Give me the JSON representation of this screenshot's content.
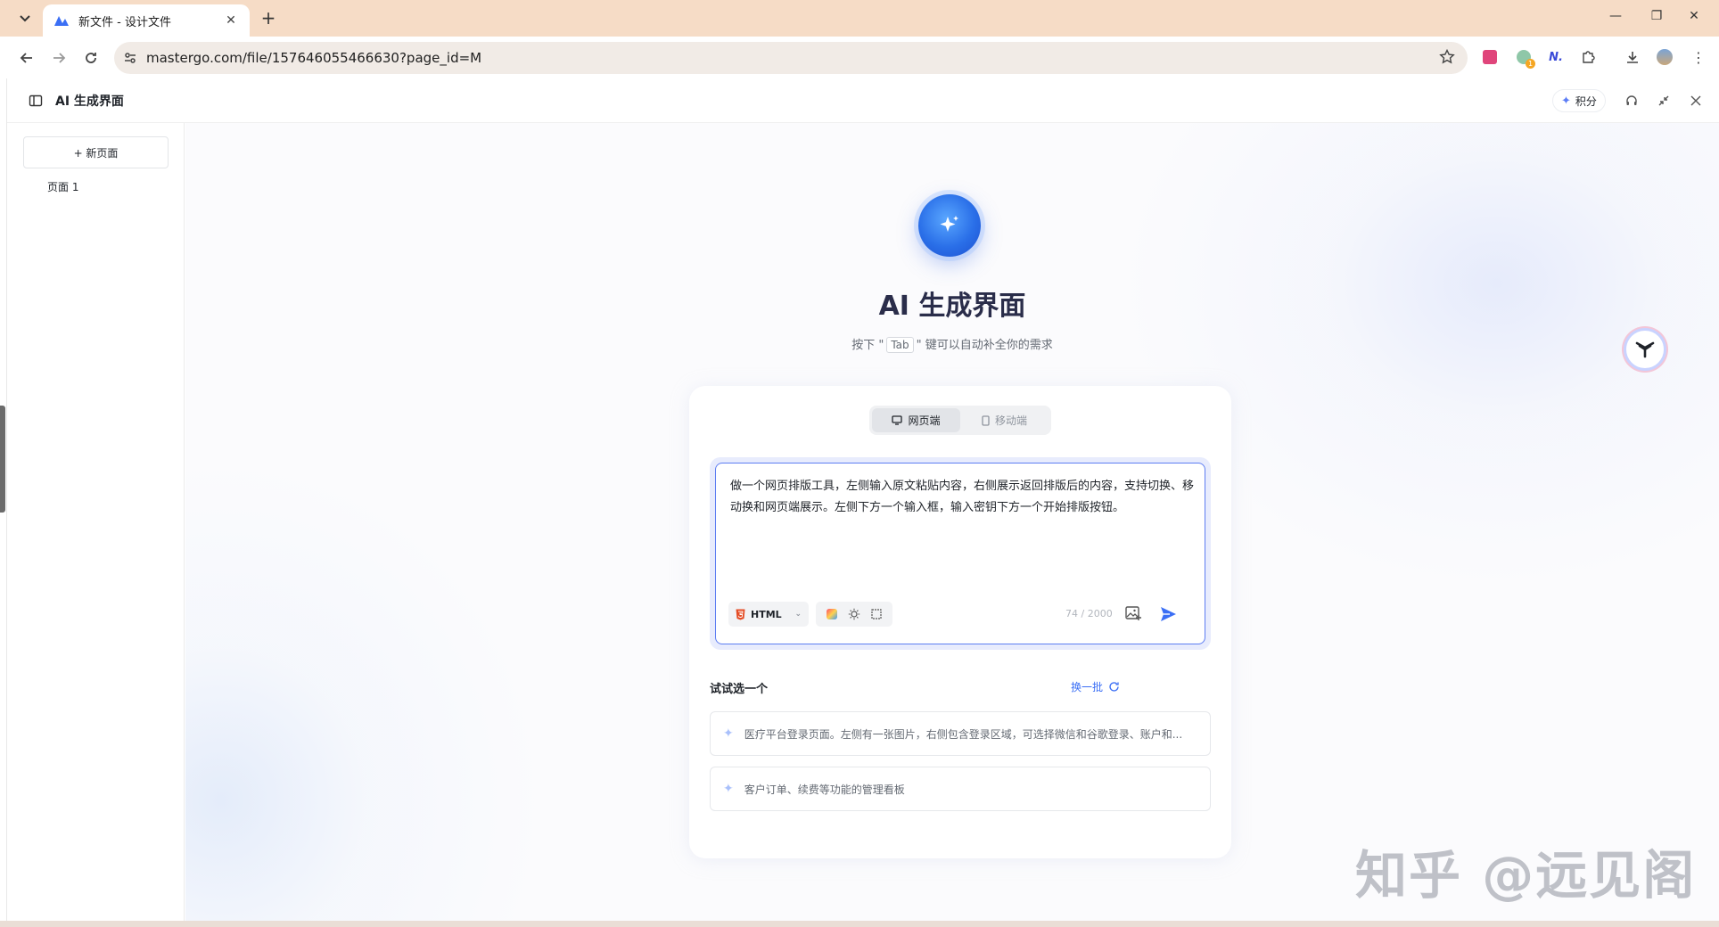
{
  "browser": {
    "tab_title": "新文件 - 设计文件",
    "url": "mastergo.com/file/157646055466630?page_id=M"
  },
  "app": {
    "title": "AI 生成界面",
    "points_label": "积分"
  },
  "sidebar": {
    "new_page_label": "+ 新页面",
    "pages": [
      "页面 1"
    ]
  },
  "hero": {
    "title": "AI 生成界面",
    "hint_before": "按下 \"",
    "hint_key": "Tab",
    "hint_after": "\" 键可以自动补全你的需求"
  },
  "mode_tabs": [
    {
      "label": "网页端",
      "active": true
    },
    {
      "label": "移动端",
      "active": false
    }
  ],
  "prompt": {
    "text": "做一个网页排版工具，左侧输入原文粘贴内容，右侧展示返回排版后的内容，支持切换、移动换和网页端展示。左侧下方一个输入框，输入密钥下方一个开始排版按钮。",
    "format": "HTML",
    "counter": "74 / 2000"
  },
  "suggestions": {
    "title": "试试选一个",
    "refresh_label": "换一批",
    "items": [
      "医疗平台登录页面。左侧有一张图片，右侧包含登录区域，可选择微信和谷歌登录、账户和...",
      "客户订单、续费等功能的管理看板"
    ]
  },
  "watermark": "知乎 @远见阁",
  "colors": {
    "accent": "#3b6ff5",
    "input_border": "#5d7df2",
    "title": "#2a2d4a"
  }
}
